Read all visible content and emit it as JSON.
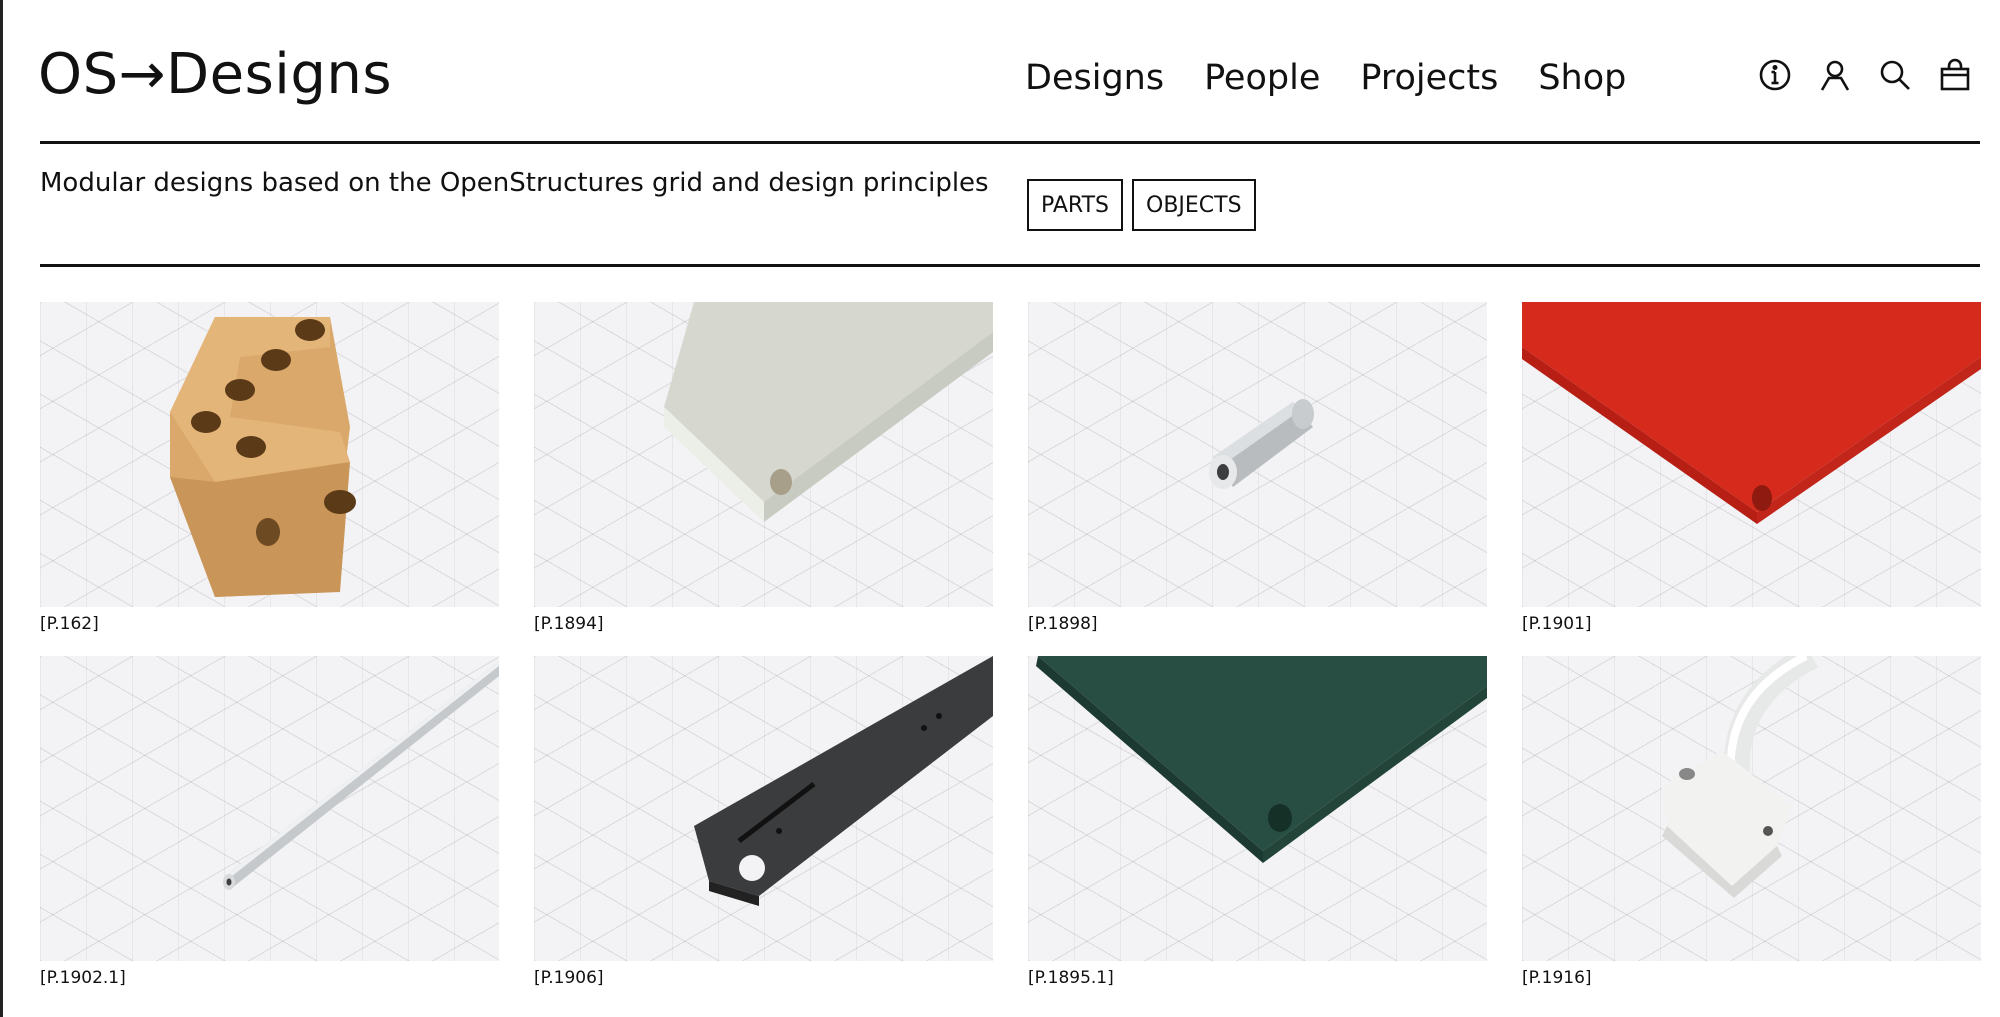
{
  "header": {
    "logo": "OS→Designs",
    "nav": [
      "Designs",
      "People",
      "Projects",
      "Shop"
    ],
    "icons": [
      "info-icon",
      "user-icon",
      "search-icon",
      "bag-icon"
    ]
  },
  "intro": {
    "tagline": "Modular designs based on the OpenStructures grid and design principles",
    "filters": [
      "PARTS",
      "OBJECTS"
    ]
  },
  "products": [
    {
      "code": "[P.162]",
      "image": "wooden-l-bracket"
    },
    {
      "code": "[P.1894]",
      "image": "grey-wood-beam"
    },
    {
      "code": "[P.1898]",
      "image": "aluminium-spacer"
    },
    {
      "code": "[P.1901]",
      "image": "red-panel"
    },
    {
      "code": "[P.1902.1]",
      "image": "aluminium-rod"
    },
    {
      "code": "[P.1906]",
      "image": "black-slotted-bar"
    },
    {
      "code": "[P.1895.1]",
      "image": "green-panel"
    },
    {
      "code": "[P.1916]",
      "image": "white-tube-bracket"
    }
  ],
  "colors": {
    "text": "#111111",
    "rule": "#111111",
    "grid_background": "#f3f3f5",
    "red_panel": "#d52a1c",
    "green_panel": "#284d43"
  }
}
